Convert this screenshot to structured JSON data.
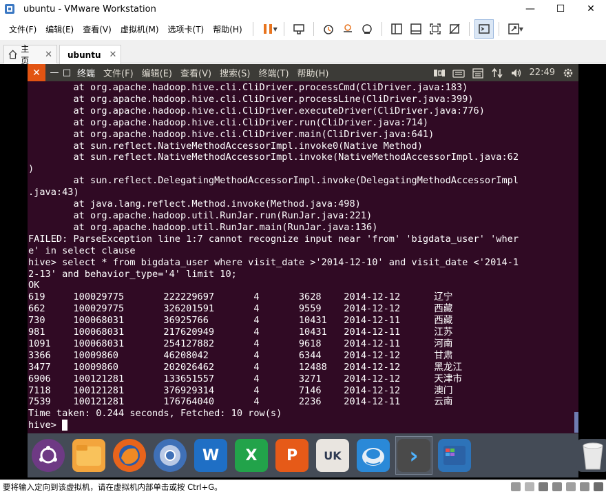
{
  "window": {
    "title": "ubuntu - VMware Workstation"
  },
  "menu": [
    "文件(F)",
    "编辑(E)",
    "查看(V)",
    "虚拟机(M)",
    "选项卡(T)",
    "帮助(H)"
  ],
  "tabs": [
    {
      "label": "主页"
    },
    {
      "label": "ubuntu"
    }
  ],
  "ubuntu_panel": {
    "menus": [
      "终端",
      "文件(F)",
      "编辑(E)",
      "查看(V)",
      "搜索(S)",
      "终端(T)",
      "帮助(H)"
    ],
    "clock": "22:49"
  },
  "terminal": {
    "lines": [
      "        at org.apache.hadoop.hive.cli.CliDriver.processCmd(CliDriver.java:183)",
      "        at org.apache.hadoop.hive.cli.CliDriver.processLine(CliDriver.java:399)",
      "        at org.apache.hadoop.hive.cli.CliDriver.executeDriver(CliDriver.java:776)",
      "        at org.apache.hadoop.hive.cli.CliDriver.run(CliDriver.java:714)",
      "        at org.apache.hadoop.hive.cli.CliDriver.main(CliDriver.java:641)",
      "        at sun.reflect.NativeMethodAccessorImpl.invoke0(Native Method)",
      "        at sun.reflect.NativeMethodAccessorImpl.invoke(NativeMethodAccessorImpl.java:62",
      ")",
      "        at sun.reflect.DelegatingMethodAccessorImpl.invoke(DelegatingMethodAccessorImpl",
      ".java:43)",
      "        at java.lang.reflect.Method.invoke(Method.java:498)",
      "        at org.apache.hadoop.util.RunJar.run(RunJar.java:221)",
      "        at org.apache.hadoop.util.RunJar.main(RunJar.java:136)",
      "FAILED: ParseException line 1:7 cannot recognize input near 'from' 'bigdata_user' 'wher",
      "e' in select clause",
      "hive> select * from bigdata_user where visit_date >'2014-12-10' and visit_date <'2014-1",
      "2-13' and behavior_type='4' limit 10;",
      "OK",
      "619     100029775       222229697       4       3628    2014-12-12      辽宁",
      "662     100029775       326201591       4       9559    2014-12-12      西藏",
      "730     100068031       36925766        4       10431   2014-12-11      西藏",
      "981     100068031       217620949       4       10431   2014-12-11      江苏",
      "1091    100068031       254127882       4       9618    2014-12-11      河南",
      "3366    10009860        46208042        4       6344    2014-12-12      甘肃",
      "3477    10009860        202026462       4       12488   2014-12-12      黑龙江",
      "6906    100121281       133651557       4       3271    2014-12-12      天津市",
      "7118    100121281       376929314       4       7146    2014-12-12      澳门",
      "7539    100121281       176764040       4       2236    2014-12-11      云南",
      "Time taken: 0.244 seconds, Fetched: 10 row(s)"
    ],
    "prompt": "hive> "
  },
  "dock": {
    "items": [
      {
        "icon": "ubuntu-dash-icon",
        "color": "#6e3a84"
      },
      {
        "icon": "files-icon",
        "color": "#f3a53d"
      },
      {
        "icon": "firefox-icon",
        "color": "#e8641b"
      },
      {
        "icon": "chromium-icon",
        "color": "#3f70b7"
      },
      {
        "icon": "writer-icon",
        "color": "#1f6fc5",
        "glyph": "W"
      },
      {
        "icon": "calc-icon",
        "color": "#22a34a",
        "glyph": "X"
      },
      {
        "icon": "impress-icon",
        "color": "#e65a18",
        "glyph": "P"
      },
      {
        "icon": "software-center-icon",
        "color": "#e9e5e0",
        "glyph": "UK"
      },
      {
        "icon": "ubuntu-amazon-icon",
        "color": "#2a89d8"
      },
      {
        "icon": "terminal-icon",
        "color": "#4a4a4a",
        "glyph": "›"
      },
      {
        "icon": "workspace-icon",
        "color": "#2d73b9"
      },
      {
        "icon": "trash-icon",
        "color": "#444b56"
      }
    ]
  },
  "status": {
    "text": "要将输入定向到该虚拟机，请在虚拟机内部单击或按 Ctrl+G。"
  }
}
